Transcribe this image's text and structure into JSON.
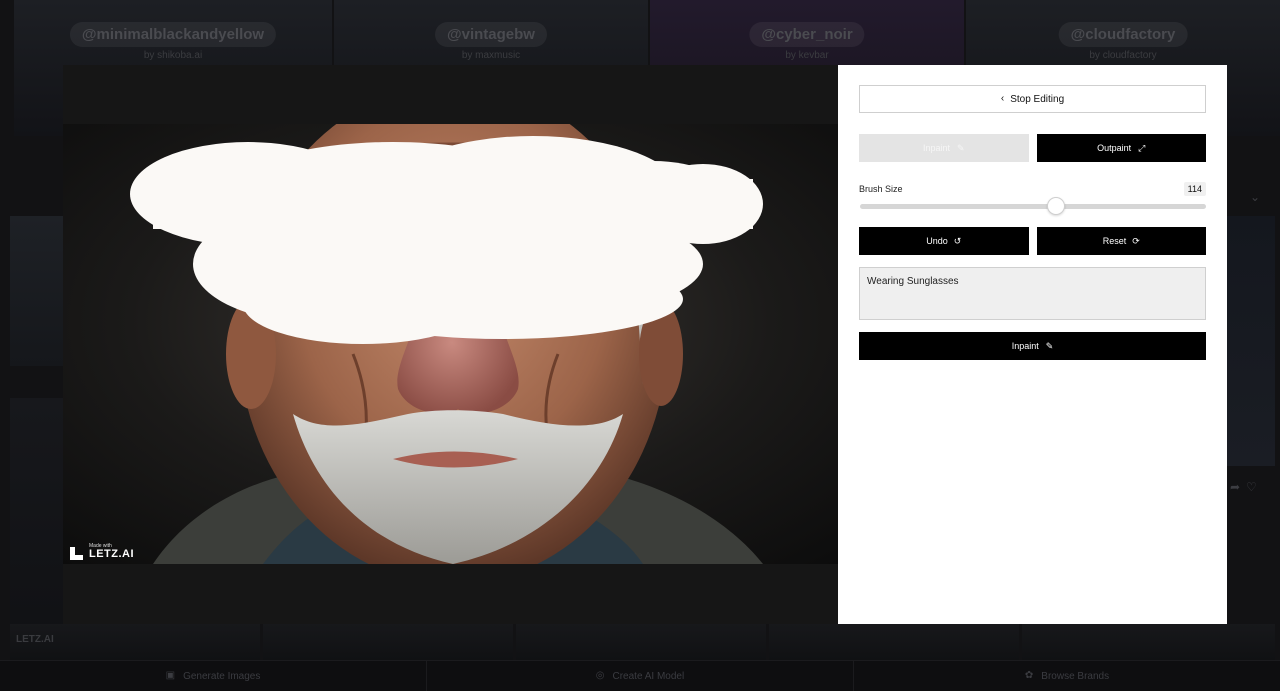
{
  "background": {
    "tiles": [
      {
        "handle": "@minimalblackandyellow",
        "by": "by shikoba.ai"
      },
      {
        "handle": "@vintagebw",
        "by": "by maxmusic"
      },
      {
        "handle": "@cyber_noir",
        "by": "by kevbar"
      },
      {
        "handle": "@cloudfactory",
        "by": "by cloudfactory"
      }
    ],
    "watermark": "LETZ.AI",
    "bottom_nav": [
      {
        "label": "Generate Images",
        "icon": "image-icon"
      },
      {
        "label": "Create AI Model",
        "icon": "model-icon"
      },
      {
        "label": "Browse Brands",
        "icon": "brands-icon"
      }
    ]
  },
  "canvas": {
    "made_with": "Made with",
    "brand": "LETZ.AI"
  },
  "panel": {
    "stop_editing": "Stop Editing",
    "modes": {
      "inpaint": "Inpaint",
      "outpaint": "Outpaint"
    },
    "brush": {
      "label": "Brush Size",
      "value": "114",
      "fraction": 0.57
    },
    "undo": "Undo",
    "reset": "Reset",
    "prompt_value": "Wearing Sunglasses",
    "submit": "Inpaint"
  }
}
